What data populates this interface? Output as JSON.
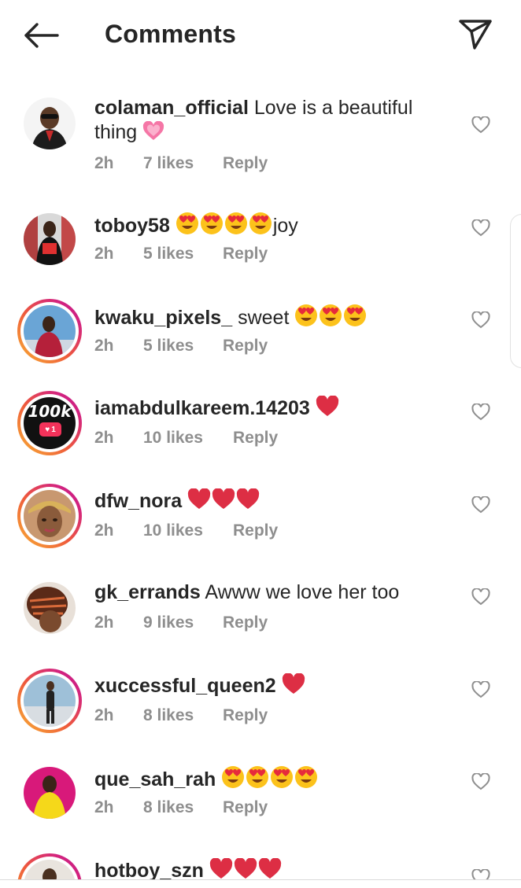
{
  "header": {
    "title": "Comments",
    "back_icon": "arrow-left-icon",
    "share_icon": "paper-plane-icon"
  },
  "colors": {
    "text": "#262626",
    "meta": "#8e8e8e",
    "heart_red": "#e0245e",
    "story_ring": [
      "#f9b233",
      "#ee5a3c",
      "#d3237f"
    ]
  },
  "comments": [
    {
      "username": "colaman_official",
      "text": "Love is a beautiful",
      "text2": "thing",
      "emoji": "heart-pink",
      "time": "2h",
      "likes": "7 likes",
      "reply": "Reply",
      "ring": false
    },
    {
      "username": "toboy58",
      "text": "joy",
      "emoji": "heart-eyes x4",
      "time": "2h",
      "likes": "5 likes",
      "reply": "Reply",
      "ring": false
    },
    {
      "username": "kwaku_pixels_",
      "text": "sweet",
      "emoji": "heart-eyes x3",
      "time": "2h",
      "likes": "5 likes",
      "reply": "Reply",
      "ring": true
    },
    {
      "username": "iamabdulkareem.14203",
      "text": "",
      "emoji": "red-heart x1",
      "time": "2h",
      "likes": "10 likes",
      "reply": "Reply",
      "ring": true,
      "avatar_text": "100k",
      "badge": "1"
    },
    {
      "username": "dfw_nora",
      "text": "",
      "emoji": "red-heart x3",
      "time": "2h",
      "likes": "10 likes",
      "reply": "Reply",
      "ring": true
    },
    {
      "username": "gk_errands",
      "text": "Awww we love her too",
      "emoji": "",
      "time": "2h",
      "likes": "9 likes",
      "reply": "Reply",
      "ring": false
    },
    {
      "username": "xuccessful_queen2",
      "text": "",
      "emoji": "red-heart x1",
      "time": "2h",
      "likes": "8 likes",
      "reply": "Reply",
      "ring": true
    },
    {
      "username": "que_sah_rah",
      "text": "",
      "emoji": "heart-eyes x4",
      "time": "2h",
      "likes": "8 likes",
      "reply": "Reply",
      "ring": false
    },
    {
      "username": "hotboy_szn",
      "text": "",
      "emoji": "red-heart x3",
      "time": "",
      "likes": "",
      "reply": "",
      "ring": true
    }
  ]
}
